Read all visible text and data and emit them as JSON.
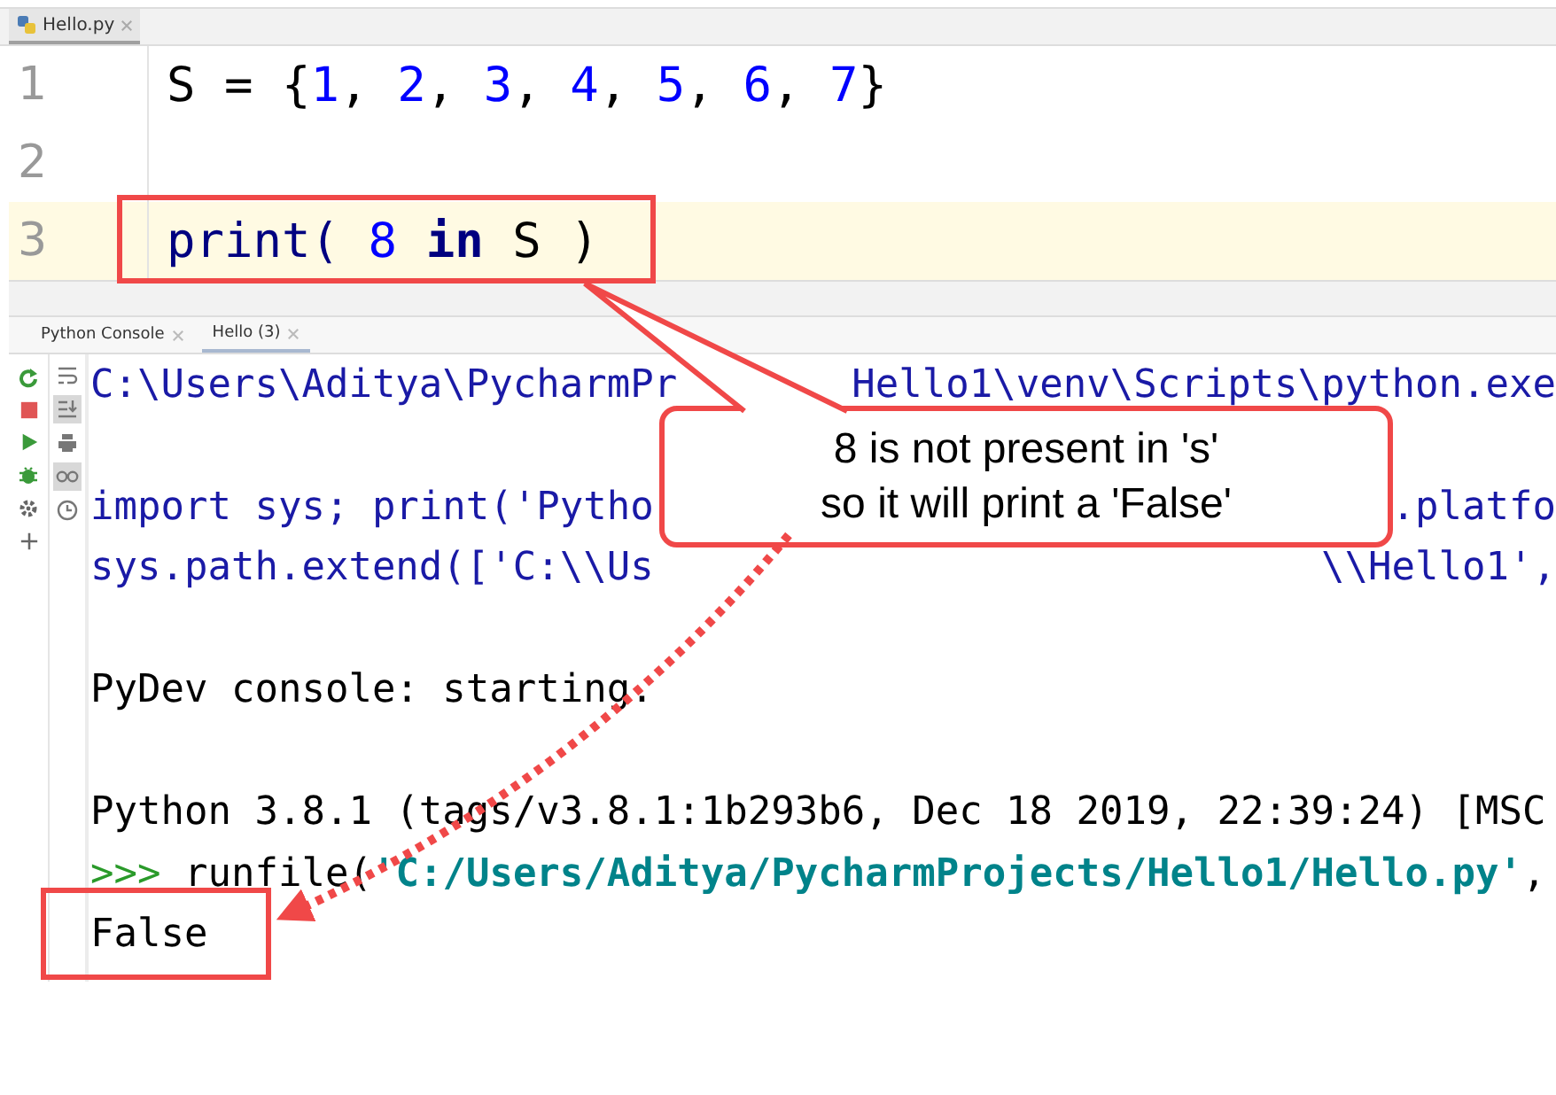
{
  "editor_tab": {
    "label": "Hello.py",
    "selected": true
  },
  "code_lines": [
    {
      "number": "1",
      "highlighted": false,
      "tokens": [
        {
          "kind": "plain",
          "text": "S = {"
        },
        {
          "kind": "number",
          "text": "1"
        },
        {
          "kind": "plain",
          "text": ", "
        },
        {
          "kind": "number",
          "text": "2"
        },
        {
          "kind": "plain",
          "text": ", "
        },
        {
          "kind": "number",
          "text": "3"
        },
        {
          "kind": "plain",
          "text": ", "
        },
        {
          "kind": "number",
          "text": "4"
        },
        {
          "kind": "plain",
          "text": ", "
        },
        {
          "kind": "number",
          "text": "5"
        },
        {
          "kind": "plain",
          "text": ", "
        },
        {
          "kind": "number",
          "text": "6"
        },
        {
          "kind": "plain",
          "text": ", "
        },
        {
          "kind": "number",
          "text": "7"
        },
        {
          "kind": "plain",
          "text": "}"
        }
      ]
    },
    {
      "number": "2",
      "highlighted": false
    },
    {
      "number": "3",
      "highlighted": true,
      "tokens": [
        {
          "kind": "builtin",
          "text": "print("
        },
        {
          "kind": "number",
          "text": " 8"
        },
        {
          "kind": "keyword",
          "text": " in"
        },
        {
          "kind": "plain",
          "text": " S )"
        }
      ]
    }
  ],
  "console_tabs": [
    {
      "label": "Python Console",
      "selected": false
    },
    {
      "label": "Hello (3)",
      "selected": true
    }
  ],
  "console_lines": [
    {
      "kind": "text",
      "segments": [
        {
          "kind": "command",
          "text": "C:\\Users\\Aditya\\PycharmPr"
        }
      ],
      "tail": {
        "kind": "command",
        "text": "Hello1\\venv\\Scripts\\python.exe"
      }
    },
    {
      "kind": "blank"
    },
    {
      "kind": "text",
      "segments": [
        {
          "kind": "command",
          "text": "import sys; print('Pytho"
        }
      ],
      "tail": {
        "kind": "command",
        "text": ".platfo"
      }
    },
    {
      "kind": "text",
      "segments": [
        {
          "kind": "command",
          "text": "sys.path.extend(['C:\\\\Us"
        }
      ],
      "tail": {
        "kind": "command",
        "text": "\\\\Hello1',"
      }
    },
    {
      "kind": "blank"
    },
    {
      "kind": "text",
      "segments": [
        {
          "kind": "output",
          "text": "PyDev console: starting."
        }
      ]
    },
    {
      "kind": "blank"
    },
    {
      "kind": "text",
      "segments": [
        {
          "kind": "output",
          "text": "Python 3.8.1 (tags/v3.8.1:1b293b6, Dec 18 2019, 22:39:24) [MSC"
        }
      ]
    },
    {
      "kind": "text",
      "segments": [
        {
          "kind": "prompt",
          "text": ">>>"
        },
        {
          "kind": "output",
          "text": " runfile("
        },
        {
          "kind": "string",
          "text": "'C:/Users/Aditya/PycharmProjects/Hello1/Hello.py'"
        },
        {
          "kind": "output",
          "text": ","
        }
      ]
    },
    {
      "kind": "text",
      "segments": [
        {
          "kind": "output",
          "text": "False"
        }
      ]
    }
  ],
  "callout": {
    "lines": [
      "8 is not present in 's'",
      "so it will print a 'False'"
    ]
  }
}
